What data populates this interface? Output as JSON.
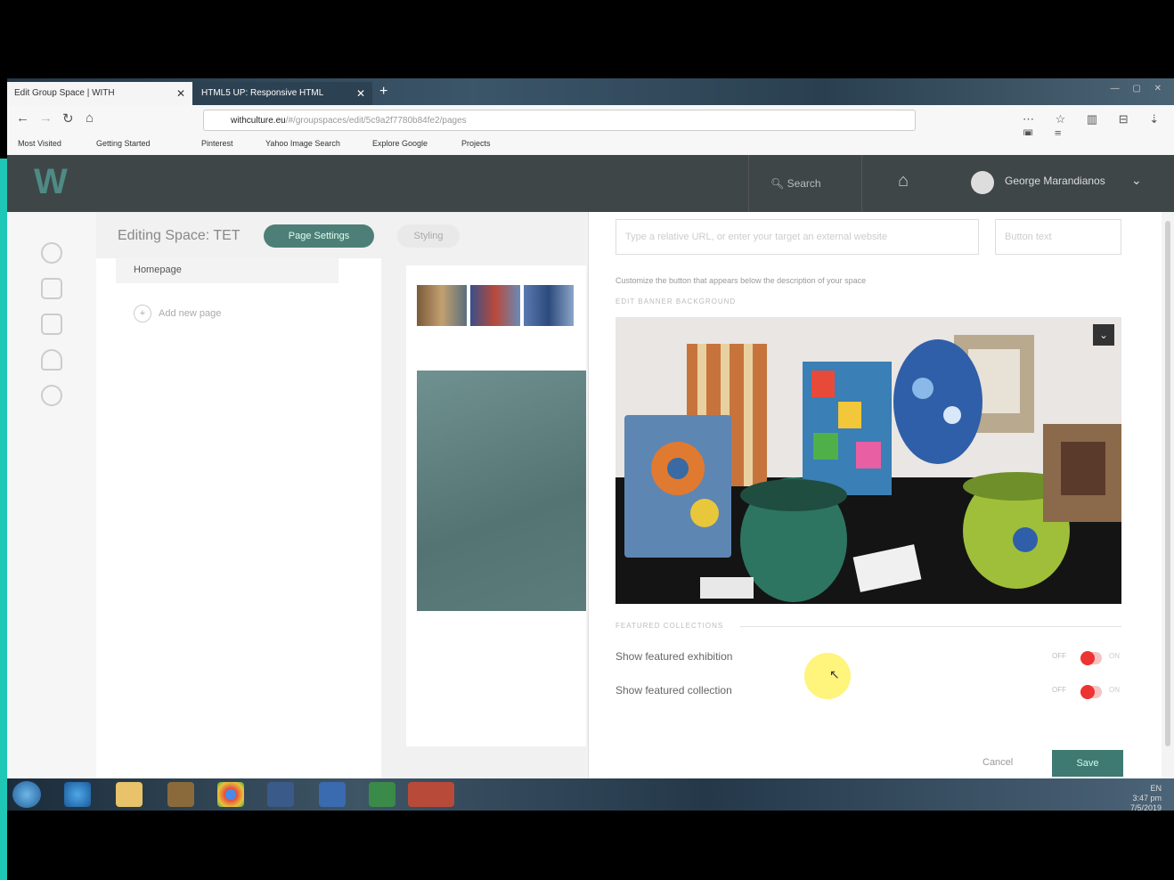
{
  "browser": {
    "tabs": [
      {
        "label": "Edit Group Space | WITH",
        "close": "✕"
      },
      {
        "label": "HTML5 UP: Responsive HTML",
        "close": "✕"
      }
    ],
    "new_tab": "+",
    "url_host": "withculture.eu",
    "url_path": "/#/groupspaces/edit/5c9a2f7780b84fe2/pages",
    "bookmarks": [
      "Most Visited",
      "Getting Started",
      "Pinterest",
      "Yahoo Image Search",
      "Explore Google",
      "Projects"
    ]
  },
  "app": {
    "search_placeholder": "Search",
    "user_name": "George Marandianos"
  },
  "editor": {
    "title": "Editing Space: TET",
    "page_settings_label": "Page Settings",
    "styling_label": "Styling",
    "pages": [
      "Homepage"
    ],
    "add_page_label": "Add new page"
  },
  "settings": {
    "url_placeholder": "Type a relative URL, or enter your target an external website",
    "button_text_placeholder": "Button text",
    "customize_hint": "Customize the button that appears below the description of your space",
    "banner_label": "EDIT BANNER BACKGROUND",
    "featured_label": "FEATURED COLLECTIONS",
    "rows": [
      {
        "label": "Show featured exhibition",
        "off": "OFF",
        "on": "ON"
      },
      {
        "label": "Show featured collection",
        "off": "OFF",
        "on": "ON"
      }
    ],
    "cancel_label": "Cancel",
    "save_label": "Save"
  },
  "taskbar": {
    "time": "3:47 pm",
    "date": "7/5/2019",
    "lang": "EN"
  },
  "colors": {
    "accent": "#4d7f78",
    "save": "#3e7a72",
    "header": "#3f4647",
    "toggle_off": "#e33333"
  }
}
